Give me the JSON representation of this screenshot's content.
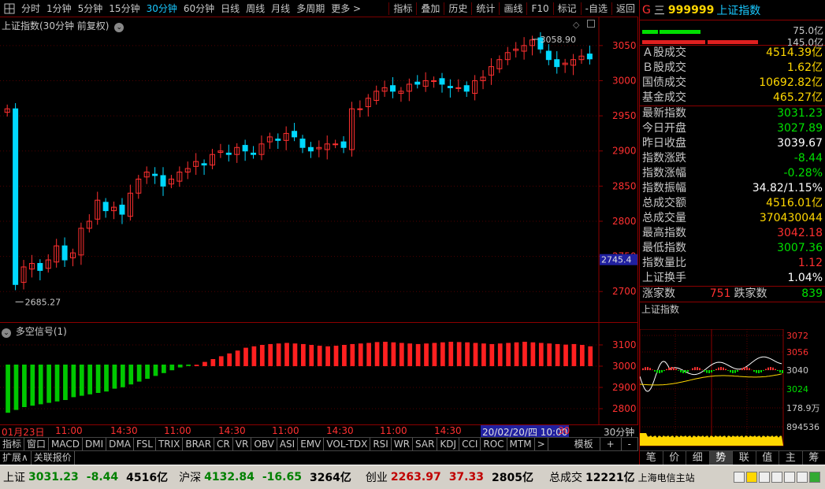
{
  "toolbar": {
    "items": [
      "分时",
      "1分钟",
      "5分钟",
      "15分钟",
      "30分钟",
      "60分钟",
      "日线",
      "周线",
      "月线",
      "多周期",
      "更多 >"
    ],
    "right_items": [
      "指标",
      "叠加",
      "历史",
      "统计",
      "画线",
      "F10",
      "标记",
      "-自选",
      "返回"
    ],
    "active": "30分钟"
  },
  "main_chart": {
    "title": "上证指数(30分钟 前复权)",
    "price_labels": [
      "3050",
      "3000",
      "2950",
      "2900",
      "2850",
      "2800",
      "2750",
      "2700"
    ],
    "high_annotation": "3058.90",
    "low_annotation": "2685.27",
    "cursor_price": "2745.4"
  },
  "indicator_chart": {
    "title": "多空信号(1)",
    "axis_labels": [
      "3100",
      "3000",
      "2900",
      "2800"
    ]
  },
  "xaxis": {
    "labels": [
      "01月23日",
      "11:00",
      "14:30",
      "11:00",
      "14:30",
      "11:00",
      "14:30",
      "11:00",
      "14:30",
      "11:00",
      "30"
    ],
    "cursor_date": "20/02/20/四 10:00",
    "period": "30分钟"
  },
  "tabstrip": {
    "items": [
      "指标",
      "窗口",
      "MACD",
      "DMI",
      "DMA",
      "FSL",
      "TRIX",
      "BRAR",
      "CR",
      "VR",
      "OBV",
      "ASI",
      "EMV",
      "VOL-TDX",
      "RSI",
      "WR",
      "SAR",
      "KDJ",
      "CCI",
      "ROC",
      "MTM",
      ">"
    ],
    "right": [
      "模板",
      "+",
      "-"
    ]
  },
  "subtabs": {
    "items": [
      "扩展∧",
      "关联报价"
    ]
  },
  "right_panel": {
    "g": "G",
    "menu": "三",
    "code": "999999",
    "name": "上证指数",
    "vol_top": "75.0亿",
    "vol_bottom": "145.0亿",
    "turnover": [
      {
        "label": "Ａ股成交",
        "value": "4514.39亿",
        "color": "yellow"
      },
      {
        "label": "Ｂ股成交",
        "value": "1.62亿",
        "color": "yellow"
      },
      {
        "label": "国债成交",
        "value": "10692.82亿",
        "color": "yellow"
      },
      {
        "label": "基金成交",
        "value": "465.27亿",
        "color": "yellow"
      }
    ],
    "stats": [
      {
        "label": "最新指数",
        "value": "3031.23",
        "color": "green"
      },
      {
        "label": "今日开盘",
        "value": "3027.89",
        "color": "green"
      },
      {
        "label": "昨日收盘",
        "value": "3039.67",
        "color": "white"
      },
      {
        "label": "指数涨跌",
        "value": "-8.44",
        "color": "green"
      },
      {
        "label": "指数涨幅",
        "value": "-0.28%",
        "color": "green"
      },
      {
        "label": "指数振幅",
        "value": "34.82/1.15%",
        "color": "white"
      },
      {
        "label": "总成交额",
        "value": "4516.01亿",
        "color": "yellow"
      },
      {
        "label": "总成交量",
        "value": "370430044",
        "color": "yellow"
      },
      {
        "label": "最高指数",
        "value": "3042.18",
        "color": "red"
      },
      {
        "label": "最低指数",
        "value": "3007.36",
        "color": "green"
      },
      {
        "label": "指数量比",
        "value": "1.12",
        "color": "red"
      },
      {
        "label": "上证换手",
        "value": "1.04%",
        "color": "white"
      }
    ],
    "breadth": {
      "up_label": "涨家数",
      "up_value": "751",
      "down_label": "跌家数",
      "down_value": "839"
    },
    "mini_title": "上证指数",
    "mini_axis": [
      "3072",
      "3056",
      "3040",
      "3024",
      "178.9万",
      "894536"
    ],
    "tabs": [
      "笔",
      "价",
      "细",
      "势",
      "联",
      "值",
      "主",
      "筹"
    ],
    "active_tab": "势"
  },
  "statusbar": {
    "sh_label": "上证",
    "sh_value": "3031.23",
    "sh_change": "-8.44",
    "sh_amount": "4516亿",
    "hs_label": "沪深",
    "hs_value": "4132.84",
    "hs_change": "-16.65",
    "hs_amount": "3264亿",
    "cy_label": "创业",
    "cy_value": "2263.97",
    "cy_change": "37.33",
    "cy_amount": "2805亿",
    "total_label": "总成交",
    "total_amount": "12221亿",
    "server": "上海电信主站"
  },
  "chart_data": {
    "type": "candlestick",
    "title": "上证指数(30分钟 前复权)",
    "ylim": [
      2670,
      3070
    ],
    "close": [
      2960,
      2710,
      2735,
      2740,
      2730,
      2745,
      2765,
      2745,
      2755,
      2790,
      2800,
      2830,
      2815,
      2820,
      2810,
      2840,
      2860,
      2870,
      2865,
      2850,
      2860,
      2870,
      2875,
      2885,
      2880,
      2895,
      2900,
      2895,
      2905,
      2900,
      2895,
      2910,
      2920,
      2915,
      2925,
      2920,
      2905,
      2900,
      2905,
      2910,
      2910,
      2905,
      2960,
      2960,
      2975,
      2985,
      2990,
      2985,
      2985,
      2995,
      2995,
      3000,
      3000,
      2995,
      2990,
      2990,
      2985,
      3000,
      3005,
      3020,
      3030,
      3040,
      3045,
      3050,
      3058,
      3045,
      3030,
      3020,
      3025,
      3030,
      3035,
      3031
    ],
    "indicator": [
      -170,
      -160,
      -150,
      -145,
      -140,
      -135,
      -130,
      -125,
      -115,
      -110,
      -105,
      -100,
      -95,
      -85,
      -80,
      -70,
      -60,
      -50,
      -40,
      -30,
      -20,
      -10,
      -5,
      5,
      15,
      25,
      35,
      45,
      55,
      65,
      70,
      75,
      78,
      80,
      82,
      80,
      78,
      75,
      72,
      70,
      72,
      75,
      78,
      80,
      82,
      85,
      86,
      84,
      82,
      80,
      78,
      80,
      82,
      84,
      86,
      85,
      84,
      82,
      80,
      78,
      80,
      82,
      84,
      86,
      84,
      82,
      80,
      78,
      76,
      78,
      75,
      70
    ]
  }
}
